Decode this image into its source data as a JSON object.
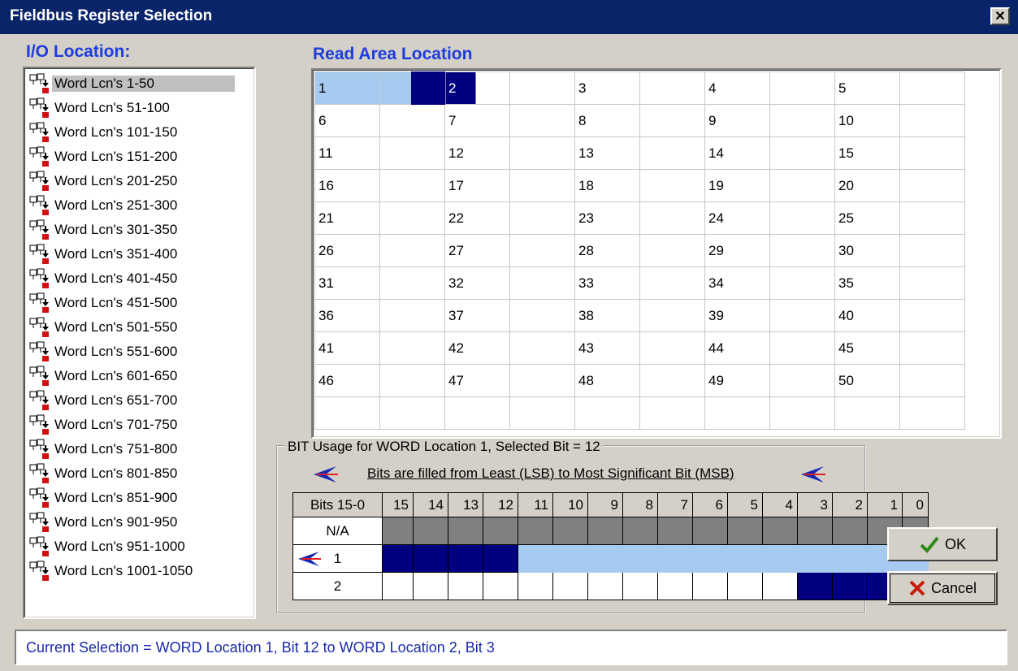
{
  "window": {
    "title": "Fieldbus Register Selection",
    "close_glyph": "✕"
  },
  "io_location": {
    "label": "I/O Location:",
    "selected_index": 0,
    "items": [
      "Word Lcn's 1-50",
      "Word Lcn's 51-100",
      "Word Lcn's 101-150",
      "Word Lcn's 151-200",
      "Word Lcn's 201-250",
      "Word Lcn's 251-300",
      "Word Lcn's 301-350",
      "Word Lcn's 351-400",
      "Word Lcn's 401-450",
      "Word Lcn's 451-500",
      "Word Lcn's 501-550",
      "Word Lcn's 551-600",
      "Word Lcn's 601-650",
      "Word Lcn's 651-700",
      "Word Lcn's 701-750",
      "Word Lcn's 751-800",
      "Word Lcn's 801-850",
      "Word Lcn's 851-900",
      "Word Lcn's 901-950",
      "Word Lcn's 951-1000",
      "Word Lcn's 1001-1050"
    ]
  },
  "read_area": {
    "label": "Read Area Location",
    "numbers": [
      [
        "1",
        "2",
        "3",
        "4",
        "5"
      ],
      [
        "6",
        "7",
        "8",
        "9",
        "10"
      ],
      [
        "11",
        "12",
        "13",
        "14",
        "15"
      ],
      [
        "16",
        "17",
        "18",
        "19",
        "20"
      ],
      [
        "21",
        "22",
        "23",
        "24",
        "25"
      ],
      [
        "26",
        "27",
        "28",
        "29",
        "30"
      ],
      [
        "31",
        "32",
        "33",
        "34",
        "35"
      ],
      [
        "36",
        "37",
        "38",
        "39",
        "40"
      ],
      [
        "41",
        "42",
        "43",
        "44",
        "45"
      ],
      [
        "46",
        "47",
        "48",
        "49",
        "50"
      ]
    ]
  },
  "bit_usage": {
    "group_title": "BIT Usage for WORD Location 1, Selected Bit = 12",
    "note": "Bits are filled from Least (LSB) to Most Significant Bit (MSB)",
    "header_label": "Bits 15-0",
    "bit_headers": [
      "15",
      "14",
      "13",
      "12",
      "11",
      "10",
      "9",
      "8",
      "7",
      "6",
      "5",
      "4",
      "3",
      "2",
      "1",
      "0"
    ],
    "rows": [
      {
        "label": "N/A",
        "marked": false,
        "cells": [
          "na",
          "na",
          "na",
          "na",
          "na",
          "na",
          "na",
          "na",
          "na",
          "na",
          "na",
          "na",
          "na",
          "na",
          "na",
          "na"
        ]
      },
      {
        "label": "1",
        "marked": true,
        "cells": [
          "sel",
          "sel",
          "sel",
          "sel",
          "free",
          "free",
          "free",
          "free",
          "free",
          "free",
          "free",
          "free",
          "free",
          "free",
          "free",
          "free"
        ]
      },
      {
        "label": "2",
        "marked": false,
        "cells": [
          "empty",
          "empty",
          "empty",
          "empty",
          "empty",
          "empty",
          "empty",
          "empty",
          "empty",
          "empty",
          "empty",
          "empty",
          "sel",
          "sel",
          "sel",
          "sel"
        ]
      }
    ]
  },
  "buttons": {
    "ok_label": "OK",
    "cancel_label": "Cancel"
  },
  "status": {
    "text": "Current Selection = WORD Location 1, Bit 12 to WORD Location 2, Bit 3"
  },
  "colors": {
    "title_bar": "#0a246a",
    "accent_blue": "#1e3cdc",
    "selected_dark": "#000080",
    "free_light": "#a6caf0",
    "na_gray": "#808080"
  }
}
